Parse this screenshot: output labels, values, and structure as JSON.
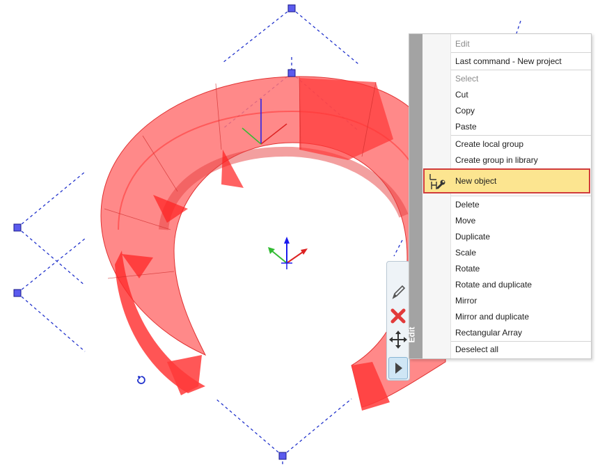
{
  "context_menu": {
    "side_label": "Edit",
    "items": [
      {
        "label": "Edit",
        "header": true
      },
      {
        "label": "Last command - New project"
      },
      {
        "label": "Select",
        "header": true
      },
      {
        "label": "Cut"
      },
      {
        "label": "Copy"
      },
      {
        "label": "Paste"
      },
      {
        "label": "Create local group"
      },
      {
        "label": "Create group in library"
      },
      {
        "label": "New object",
        "highlighted": true,
        "icon": "new-object-tool-icon"
      },
      {
        "label": "Delete"
      },
      {
        "label": "Move"
      },
      {
        "label": "Duplicate"
      },
      {
        "label": "Scale"
      },
      {
        "label": "Rotate"
      },
      {
        "label": "Rotate and duplicate"
      },
      {
        "label": "Mirror"
      },
      {
        "label": "Mirror and duplicate"
      },
      {
        "label": "Rectangular Array"
      },
      {
        "label": "Deselect all"
      }
    ]
  },
  "toolbar": {
    "icons": [
      "pencil-icon",
      "delete-x-icon",
      "move-arrows-icon",
      "play-arrow-icon"
    ]
  },
  "colors": {
    "object_red": "#ff4a4a",
    "handle_blue": "#4444dd",
    "highlight": "#fce590",
    "highlight_border": "#d03b3b"
  }
}
